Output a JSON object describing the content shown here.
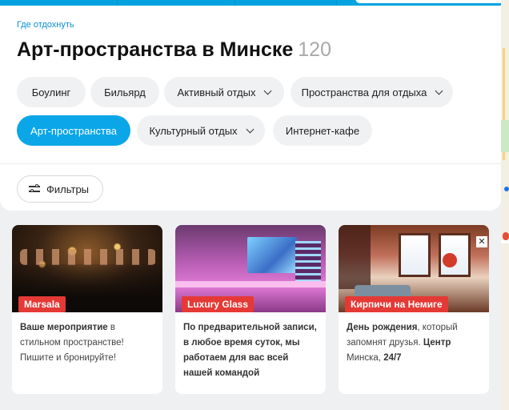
{
  "breadcrumb": "Где отдохнуть",
  "title": "Арт-пространства в Минске",
  "count": "120",
  "chips": [
    {
      "label": "Боулинг",
      "dropdown": false,
      "active": false
    },
    {
      "label": "Бильярд",
      "dropdown": false,
      "active": false
    },
    {
      "label": "Активный отдых",
      "dropdown": true,
      "active": false
    },
    {
      "label": "Пространства для отдыха",
      "dropdown": true,
      "active": false
    },
    {
      "label": "Арт-пространства",
      "dropdown": false,
      "active": true
    },
    {
      "label": "Культурный отдых",
      "dropdown": true,
      "active": false
    },
    {
      "label": "Интернет-кафе",
      "dropdown": false,
      "active": false
    }
  ],
  "filters_label": "Фильтры",
  "cards": [
    {
      "tag": "Marsala",
      "desc_bold_1": "Ваше мероприятие",
      "desc_rest_1": " в стильном пространстве! Пишите и бронируйте!"
    },
    {
      "tag": "Luxury Glass",
      "desc_bold_1": "По предварительной записи, в любое время суток, мы работаем для вас всей нашей командой",
      "desc_rest_1": ""
    },
    {
      "tag": "Кирпичи на Немиге",
      "desc_bold_1": "День рождения",
      "desc_rest_1": ", который запомнят друзья. ",
      "desc_bold_2": "Центр",
      "desc_rest_2": " Минска, ",
      "desc_bold_3": "24/7"
    }
  ],
  "colors": {
    "accent": "#0aa6e8",
    "tag": "#e53935",
    "link": "#0a8fd0"
  }
}
